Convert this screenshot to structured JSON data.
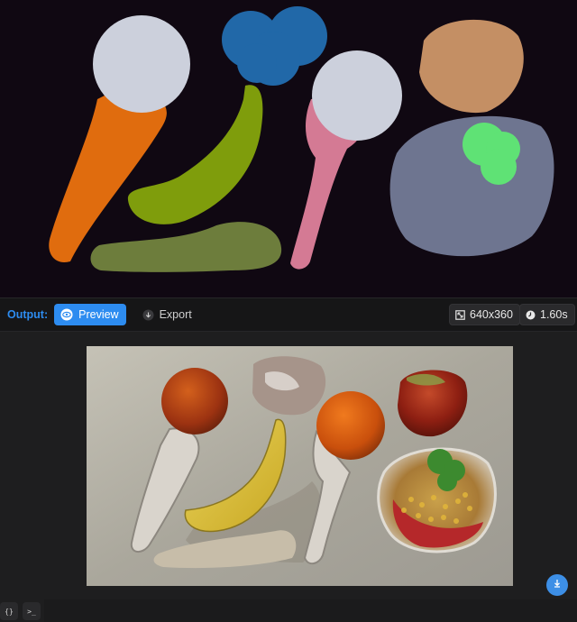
{
  "toolbar": {
    "output_label": "Output:",
    "preview_label": "Preview",
    "export_label": "Export",
    "resolution": "640x360",
    "time": "1.60s"
  },
  "icons": {
    "preview": "eye-icon",
    "export": "download-icon",
    "resolution": "aspect-ratio-icon",
    "time": "clock-icon",
    "download": "download-icon",
    "json": "braces-icon",
    "terminal": "terminal-icon"
  },
  "bottom": {
    "json_label": "{}",
    "terminal_label": ">_"
  },
  "colors": {
    "accent": "#2d8cf0",
    "canvas_bg": "#100812",
    "orange_segment": "#e06c0e",
    "white_segment": "#ccd0dc",
    "blue_segment": "#2168a8",
    "green_segment": "#7f9d0c",
    "olive_segment": "#6d7d3c",
    "pink_segment": "#d47a94",
    "tan_segment": "#c48f64",
    "gray_segment": "#6e7590",
    "lightgreen_segment": "#5fe275"
  }
}
